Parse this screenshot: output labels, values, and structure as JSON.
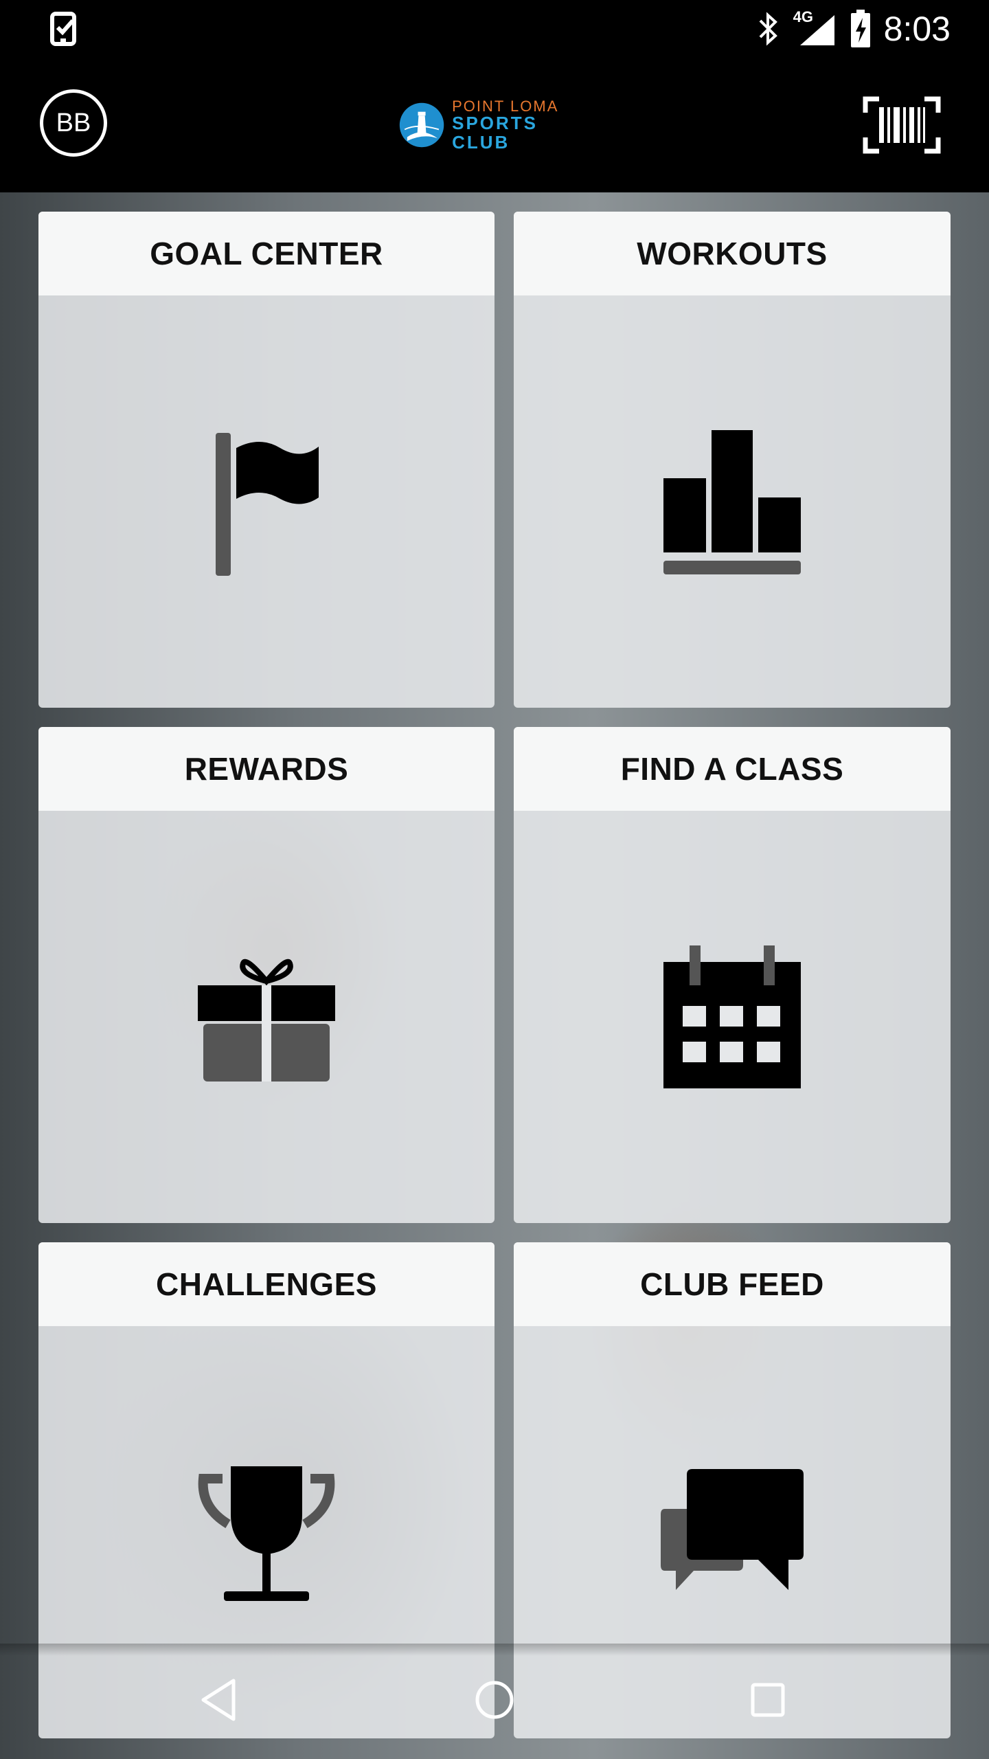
{
  "status_bar": {
    "time": "8:03",
    "network": "4G",
    "icons": [
      "task-check-icon",
      "bluetooth-icon",
      "signal-icon",
      "battery-charging-icon"
    ]
  },
  "header": {
    "avatar_initials": "BB",
    "logo_line1": "POINT LOMA",
    "logo_line2": "SPORTS CLUB",
    "barcode_icon": "barcode-scan-icon"
  },
  "tiles": [
    {
      "label": "GOAL CENTER",
      "icon": "flag-icon"
    },
    {
      "label": "WORKOUTS",
      "icon": "bar-chart-icon"
    },
    {
      "label": "REWARDS",
      "icon": "gift-icon"
    },
    {
      "label": "FIND A CLASS",
      "icon": "calendar-icon"
    },
    {
      "label": "CHALLENGES",
      "icon": "trophy-icon"
    },
    {
      "label": "CLUB FEED",
      "icon": "chat-bubbles-icon"
    }
  ],
  "nav_bar": {
    "buttons": [
      "back-icon",
      "home-icon",
      "recents-icon"
    ]
  },
  "colors": {
    "logo_orange": "#e8772e",
    "logo_blue": "#2aa6de"
  }
}
